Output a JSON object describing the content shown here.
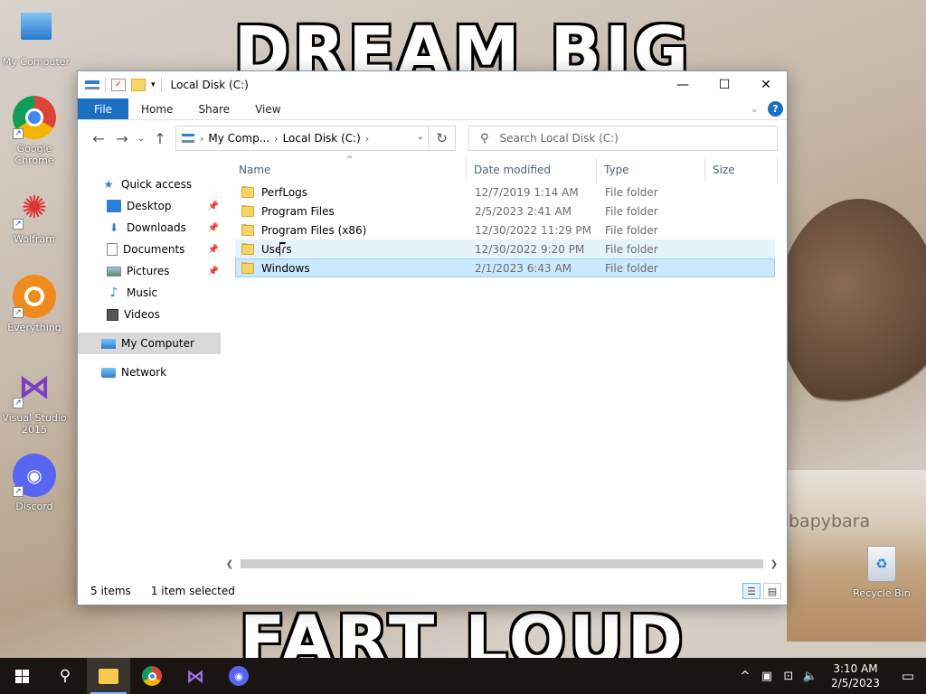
{
  "wallpaper": {
    "top_text": "DREAM BIG",
    "bottom_text": "FART LOUD",
    "brand_text": "bapybara"
  },
  "desktop_icons": [
    {
      "label": "My Computer",
      "icon": "computer-icon"
    },
    {
      "label": "Google Chrome",
      "icon": "chrome-icon"
    },
    {
      "label": "Wolfram",
      "icon": "wolfram-icon"
    },
    {
      "label": "Everything",
      "icon": "everything-icon"
    },
    {
      "label": "Visual Studio 2015",
      "icon": "visual-studio-icon"
    },
    {
      "label": "Discord",
      "icon": "discord-icon"
    }
  ],
  "recycle_bin": {
    "label": "Recycle Bin"
  },
  "window": {
    "title": "Local Disk (C:)",
    "ribbon_tabs": [
      "File",
      "Home",
      "Share",
      "View"
    ],
    "help": "?",
    "address": {
      "crumbs": [
        "My Comp...",
        "Local Disk (C:)"
      ]
    },
    "search_placeholder": "Search Local Disk (C:)",
    "sidebar": {
      "quick_access": "Quick access",
      "items": [
        {
          "label": "Desktop",
          "icon": "desktop-icon",
          "pinned": true
        },
        {
          "label": "Downloads",
          "icon": "downloads-icon",
          "pinned": true
        },
        {
          "label": "Documents",
          "icon": "documents-icon",
          "pinned": true
        },
        {
          "label": "Pictures",
          "icon": "pictures-icon",
          "pinned": true
        },
        {
          "label": "Music",
          "icon": "music-icon",
          "pinned": false
        },
        {
          "label": "Videos",
          "icon": "videos-icon",
          "pinned": false
        }
      ],
      "my_computer": "My Computer",
      "network": "Network"
    },
    "columns": {
      "name": "Name",
      "date": "Date modified",
      "type": "Type",
      "size": "Size"
    },
    "files": [
      {
        "name": "PerfLogs",
        "date": "12/7/2019 1:14 AM",
        "type": "File folder"
      },
      {
        "name": "Program Files",
        "date": "2/5/2023 2:41 AM",
        "type": "File folder"
      },
      {
        "name": "Program Files (x86)",
        "date": "12/30/2022 11:29 PM",
        "type": "File folder"
      },
      {
        "name": "Users",
        "date": "12/30/2022 9:20 PM",
        "type": "File folder"
      },
      {
        "name": "Windows",
        "date": "2/1/2023 6:43 AM",
        "type": "File folder"
      }
    ],
    "status": {
      "count": "5 items",
      "selection": "1 item selected"
    }
  },
  "taskbar": {
    "clock_time": "3:10 AM",
    "clock_date": "2/5/2023"
  },
  "colors": {
    "accent": "#1a6fc2",
    "selection": "#cce8ff",
    "hover": "#e5f3fb",
    "taskbar": "#1a1512"
  }
}
